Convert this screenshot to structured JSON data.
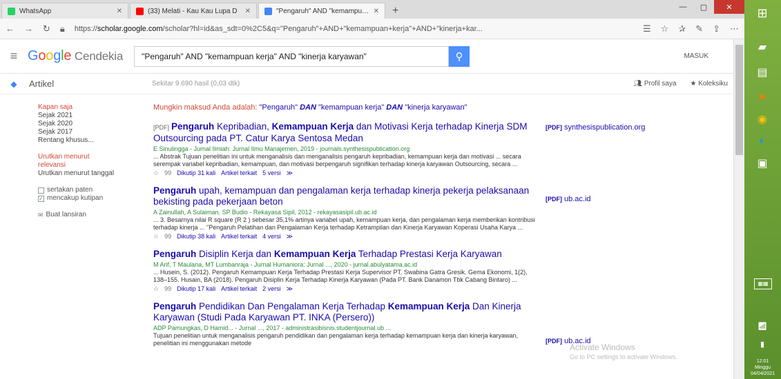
{
  "browser": {
    "tabs": [
      {
        "label": "WhatsApp",
        "color": "#25d366"
      },
      {
        "label": "(33) Melati - Kau Kau Lupa D",
        "color": "#ff0000"
      },
      {
        "label": "\"Pengaruh\" AND \"kemampuan k",
        "color": "#4285f4"
      }
    ],
    "new_tab": "+",
    "url_prefix": "https://",
    "url_host": "scholar.google.com",
    "url_path": "/scholar?hl=id&as_sdt=0%2C5&q=\"Pengaruh\"+AND+\"kemampuan+kerja\"+AND+\"kinerja+kar..."
  },
  "header": {
    "logo_g": "G",
    "logo_o1": "o",
    "logo_o2": "o",
    "logo_g2": "g",
    "logo_l": "l",
    "logo_e": "e",
    "logo_rest": " Cendekia",
    "query": "\"Pengaruh\" AND \"kemampuan kerja\" AND \"kinerja karyawan\"",
    "login": "MASUK"
  },
  "subheader": {
    "section": "Artikel",
    "result_count": "Sekitar 9.690 hasil (0,03 dtk)",
    "my_profile": "Profil saya",
    "library": "Koleksiku"
  },
  "sidebar": {
    "any_time": "Kapan saja",
    "since_2021": "Sejak 2021",
    "since_2020": "Sejak 2020",
    "since_2017": "Sejak 2017",
    "custom_range": "Rentang khusus...",
    "sort_relevance": "Urutkan menurut relevansi",
    "sort_date": "Urutkan menurut tanggal",
    "include_patents": "sertakan paten",
    "include_citations": "mencakup kutipan",
    "create_alert": "Buat lansiran"
  },
  "did_you_mean": {
    "prefix": "Mungkin maksud Anda adalah:",
    "p1": "\"Pengaruh\"",
    "op1": "DAN",
    "p2": "\"kemampuan kerja\"",
    "op2": "DAN",
    "p3": "\"kinerja karyawan\""
  },
  "results": [
    {
      "pdf_tag": "[PDF]",
      "t1": "Pengaruh",
      "t2": " Kepribadian, ",
      "t3": "Kemampuan Kerja",
      "t4": " dan Motivasi Kerja terhadap Kinerja SDM Outsourcing pada PT. Catur Karya Sentosa Medan",
      "authors": "E Sinulingga - Jurnal Ilmiah: Jurnal Ilmu Manajemen, 2019 - journals.synthesispublication.org",
      "snippet": "... Abstrak Tujuan penelitian ini untuk menganalisis dan menganalisis pengaruh kepribadian, kemampuan kerja dan motivasi ... secara serempak variabel kepribadian, kemampuan, dan motivasi berpengaruh signifikan terhadap kinerja karyawan Outsourcing, secara ...",
      "cited": "Dikutip 31 kali",
      "related": "Artikel terkait",
      "versions": "5 versi",
      "side_tag": "[PDF]",
      "side_host": "synthesispublication.org"
    },
    {
      "pdf_tag": "",
      "t1": "Pengaruh",
      "t2": " upah, kemampuan dan pengalaman kerja terhadap kinerja pekerja pelaksanaan bekisting pada pekerjaan beton",
      "t3": "",
      "t4": "",
      "authors": "A Zainullah, A Sulaiman, SP Budio - Rekayasa Sipil, 2012 - rekayasasipil.ub.ac.id",
      "snippet": "... 3. Besarnya nilai R square (R 2 ) sebesar 35,1% artinya variabel upah, kemampuan kerja, dan pengalaman kerja memberikan kontribusi terhadap kinerja ... \"Pengaruh Pelatihan dan Pengalaman Kerja terhadap Ketrampilan dan Kinerja Karyawan Koperasi Usaha Karya ...",
      "cited": "Dikutip 38 kali",
      "related": "Artikel terkait",
      "versions": "4 versi",
      "side_tag": "[PDF]",
      "side_host": "ub.ac.id"
    },
    {
      "pdf_tag": "",
      "t1": "Pengaruh",
      "t2": " Disiplin Kerja dan ",
      "t3": "Kemampuan Kerja",
      "t4": " Terhadap Prestasi Kerja Karyawan",
      "authors": "M Arif, T Maulana, MT Lumbanraja - Jurnal Humaniora: Jurnal ..., 2020 - jurnal.abulyatama.ac.id",
      "snippet": "... Husein, S. (2012). Pengaruh Kemampuan Kerja Terhadap Prestasi Kerja Supervisor PT. Swabina Gatra Gresik. Gema Ekonomi, 1(2), 138–155. Husain, BA (2018). Pengaruh Disiplin Kerja Terhadap Kinerja Karyawan (Pada PT. Bank Danamon Tbk Cabang Bintaro) ...",
      "cited": "Dikutip 17 kali",
      "related": "Artikel terkait",
      "versions": "2 versi",
      "side_tag": "",
      "side_host": ""
    },
    {
      "pdf_tag": "",
      "t1": "Pengaruh",
      "t2": " Pendidikan Dan Pengalaman Kerja Terhadap ",
      "t3": "Kemampuan Kerja",
      "t4": " Dan Kinerja Karyawan (Studi Pada Karyawan PT. INKA (Persero))",
      "authors": "ADP Pamungkas, D Hamid... - Jurnal ..., 2017 - administrasibisnis.studentjournal.ub ...",
      "snippet": "Tujuan penelitian untuk menganalisis pengaruh pendidikan dan pengalaman kerja terhadap kemampuan kerja dan kinerja karyawan, penelitian ini menggunakan metode",
      "cited": "",
      "related": "",
      "versions": "",
      "side_tag": "[PDF]",
      "side_host": "ub.ac.id"
    }
  ],
  "watermark": {
    "line1": "Activate Windows",
    "line2": "Go to PC settings to activate Windows."
  },
  "taskbar": {
    "clock_time": "12:01",
    "clock_day": "Minggu",
    "clock_date": "04/04/2021"
  }
}
